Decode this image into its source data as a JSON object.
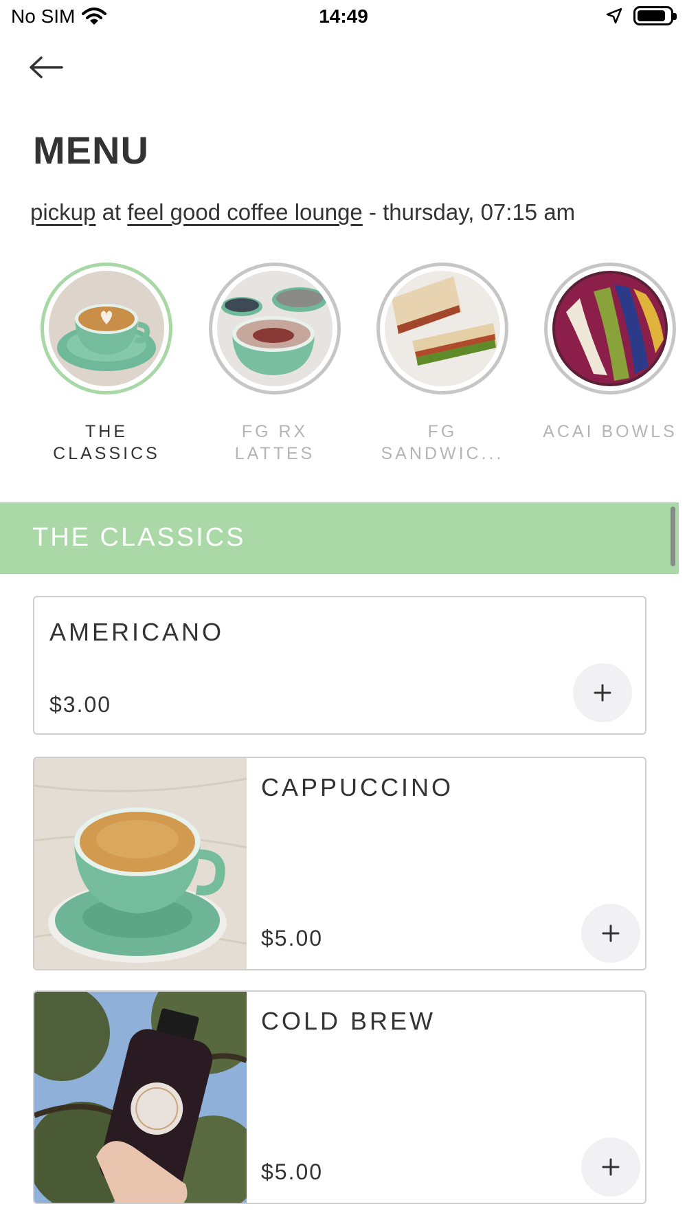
{
  "status_bar": {
    "carrier": "No SIM",
    "time": "14:49"
  },
  "header": {
    "title": "MENU"
  },
  "order_info": {
    "mode": "pickup",
    "connector": "at",
    "location": "feel good coffee lounge",
    "schedule": "- thursday, 07:15 am"
  },
  "categories": [
    {
      "label": "THE CLASSICS",
      "active": true
    },
    {
      "label": "FG RX LATTES",
      "active": false
    },
    {
      "label": "FG SANDWIC...",
      "active": false
    },
    {
      "label": "ACAI BOWLS",
      "active": false
    }
  ],
  "section": {
    "title": "THE CLASSICS"
  },
  "items": [
    {
      "name": "AMERICANO",
      "price": "$3.00",
      "add_icon": "plus-icon"
    },
    {
      "name": "CAPPUCCINO",
      "price": "$5.00",
      "add_icon": "plus-icon"
    },
    {
      "name": "COLD BREW",
      "price": "$5.00",
      "add_icon": "plus-icon"
    }
  ],
  "colors": {
    "accent_green": "#aad8a7",
    "text": "#333333",
    "inactive_text": "#b5b5b5"
  }
}
